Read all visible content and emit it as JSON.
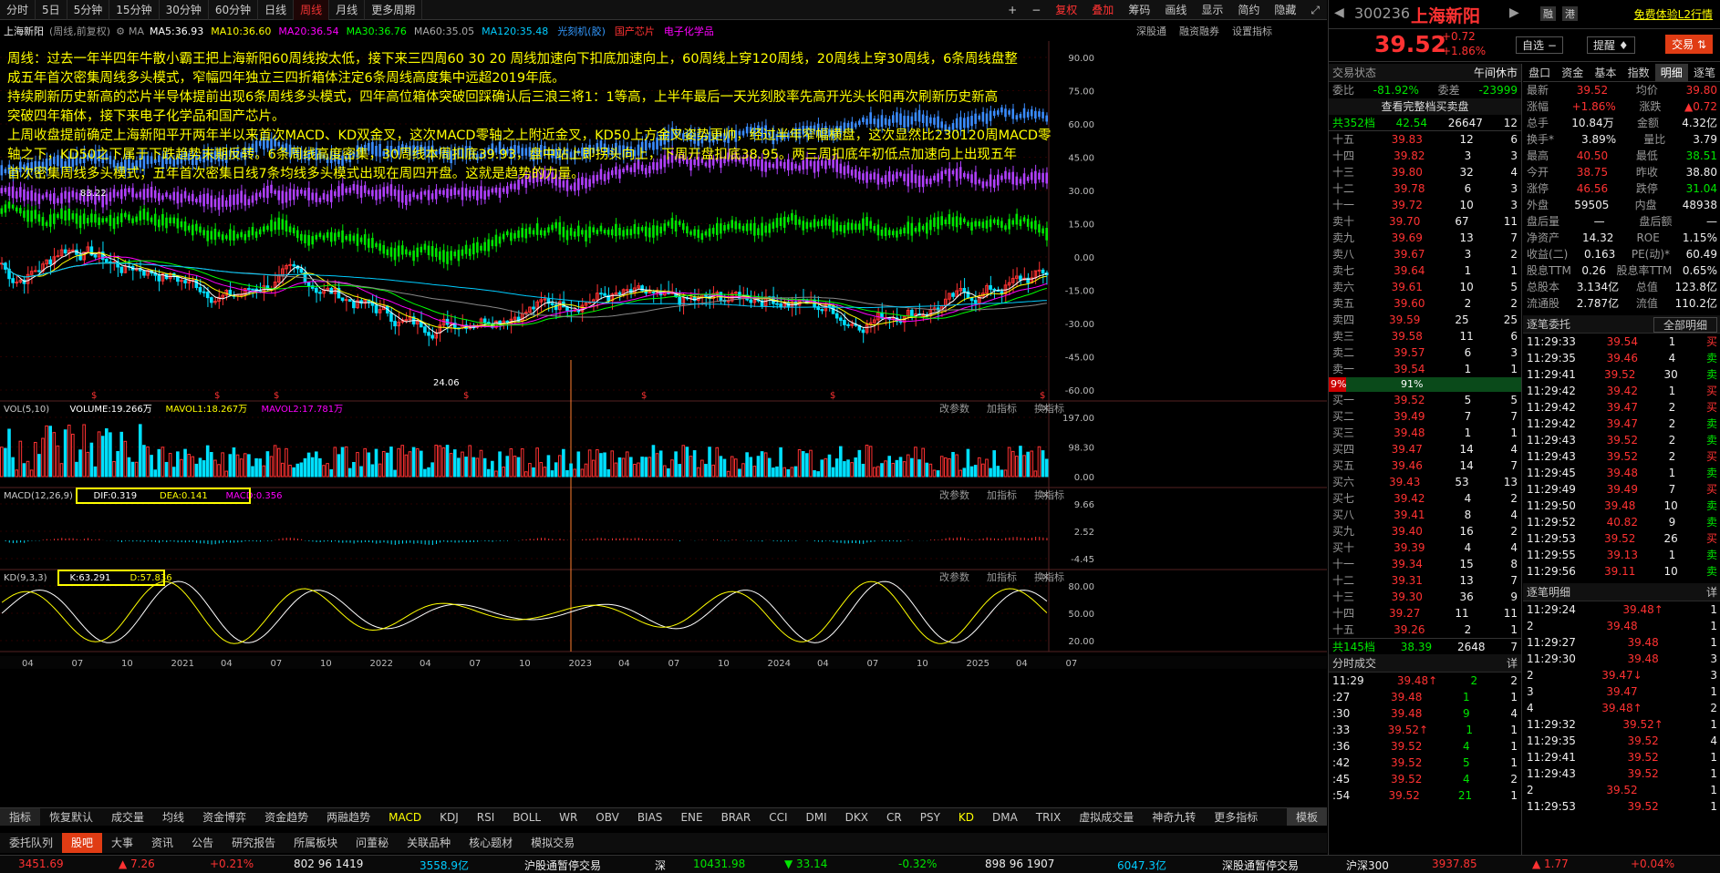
{
  "toolbar": {
    "tabs": [
      "分时",
      "5日",
      "5分钟",
      "15分钟",
      "30分钟",
      "60分钟",
      "日线",
      "周线",
      "月线",
      "更多周期"
    ],
    "active": "周线",
    "right": [
      "+",
      "−",
      "复权",
      "叠加",
      "筹码",
      "画线",
      "显示",
      "简约",
      "隐藏",
      "⤢"
    ]
  },
  "ma_row": {
    "stock": "上海新阳",
    "mode": "(周线,前复权)",
    "ma5": "MA5:36.93",
    "ma10": "MA10:36.60",
    "ma20": "MA20:36.54",
    "ma30": "MA30:36.76",
    "ma60": "MA60:35.05",
    "ma120": "MA120:35.48",
    "tags": [
      "光刻机(胶)",
      "国产芯片",
      "电子化学品"
    ],
    "links": [
      "深股通",
      "融资融券",
      "设置指标"
    ]
  },
  "annotation": [
    "周线：过去一年半四年牛散小霸王把上海新阳60周线按太低，接下来三四周60 30 20 周线加速向下扣底加速向上，60周线上穿120周线，20周线上穿30周线，6条周线盘整",
    "成五年首次密集周线多头模式，窄幅四年独立三四折箱体注定6条周线高度集中远超2019年底。",
    "持续刷新历史新高的芯片半导体提前出现6条周线多头模式，四年高位箱体突破回踩确认后三浪三将1：1等高，上半年最后一天光刻胶率先高开光头长阳再次刷新历史新高",
    "突破四年箱体，接下来电子化学品和国产芯片。",
    "上周收盘提前确定上海新阳平开两年半以来首次MACD、KD双金叉，这次MACD零轴之上附近金叉，KD50上方金叉姿势更帅，经过半年窄幅横盘，这次显然比230120周MACD零",
    "轴之下，KD50之下属于下跌趋势末期反转。6条周线高度密集，30周线本周扣底39.93，盘中站上即拐头向上，下周开盘扣底38.95。两三周扣底年初低点加速向上出现五年",
    "首次密集周线多头模式；五年首次密集日线7条均线多头模式出现在周四开盘。这就是趋势的力量。"
  ],
  "price_axis": [
    "90.00",
    "75.00",
    "60.00",
    "45.00",
    "30.00",
    "15.00",
    "0.00",
    "-15.00",
    "-30.00",
    "-45.00",
    "-60.00"
  ],
  "hi_label": "83.22",
  "lo_label": "24.06",
  "vol": {
    "title": "VOL(5,10)",
    "volume": "VOLUME:19.266万",
    "mavol1": "MAVOL1:18.267万",
    "mavol2": "MAVOL2:17.781万",
    "axis": [
      "197.00",
      "98.30",
      "0.00"
    ]
  },
  "macd": {
    "title": "MACD(12,26,9)",
    "dif": "DIF:0.319",
    "dea": "DEA:0.141",
    "macd": "MACD:0.356",
    "axis": [
      "9.66",
      "2.52",
      "-4.45"
    ]
  },
  "kd": {
    "title": "KD(9,3,3)",
    "k": "K:63.291",
    "d": "D:57.836",
    "axis": [
      "80.00",
      "50.00",
      "20.00"
    ]
  },
  "panel_btns": [
    "改参数",
    "加指标",
    "换指标"
  ],
  "xaxis": [
    "04",
    "07",
    "10",
    "2021",
    "04",
    "07",
    "10",
    "2022",
    "04",
    "07",
    "10",
    "2023",
    "04",
    "07",
    "10",
    "2024",
    "04",
    "07",
    "10",
    "2025",
    "04",
    "07"
  ],
  "ind_tabs": [
    "指标",
    "恢复默认",
    "成交量",
    "均线",
    "资金博弈",
    "资金趋势",
    "两融趋势",
    "MACD",
    "KDJ",
    "RSI",
    "BOLL",
    "WR",
    "OBV",
    "BIAS",
    "ENE",
    "BRAR",
    "CCI",
    "DMI",
    "DKX",
    "CR",
    "PSY",
    "KD",
    "DMA",
    "TRIX",
    "虚拟成交量",
    "神奇九转",
    "更多指标",
    "模板"
  ],
  "bot_tabs": [
    "委托队列",
    "股吧",
    "大事",
    "资讯",
    "公告",
    "研究报告",
    "所属板块",
    "问董秘",
    "关联品种",
    "核心题材",
    "模拟交易"
  ],
  "status": {
    "sh": "3451.69",
    "sh_chg": "▲ 7.26",
    "sh_pct": "+0.21%",
    "sh_cnt": "802 96 1419",
    "sh_amt": "3558.9亿",
    "sh_note": "沪股通暂停交易",
    "sz_lbl": "深",
    "sz": "10431.98",
    "sz_chg": "▼ 33.14",
    "sz_pct": "-0.32%",
    "sz_cnt": "898 96 1907",
    "sz_amt": "6047.3亿",
    "sz_note": "深股通暂停交易",
    "hs_lbl": "沪深300",
    "hs": "3937.85",
    "hs_chg": "▲ 1.77",
    "hs_pct": "+0.04%"
  },
  "rp": {
    "code": "300236",
    "name": "上海新阳",
    "badges": [
      "融",
      "港"
    ],
    "promo": "免费体验L2行情",
    "price": "39.52",
    "chg": "+0.72",
    "pct": "+1.86%",
    "btns": [
      "自选 −",
      "提醒 ♦",
      "交易 ⇅"
    ],
    "state_lbl": "交易状态",
    "state": "午间休市",
    "tabs": [
      "盘口",
      "资金",
      "基本",
      "指数",
      "明细",
      "逐笔"
    ],
    "weibi": [
      "委比",
      "-81.92%",
      "委差",
      "-23999"
    ],
    "full_btn": "查看完整档买卖盘",
    "sell_sum": [
      "共352档",
      "42.54",
      "26647",
      "12"
    ],
    "sells": [
      [
        "十五",
        "39.83",
        "12",
        "6"
      ],
      [
        "十四",
        "39.82",
        "3",
        "3"
      ],
      [
        "十三",
        "39.80",
        "32",
        "4"
      ],
      [
        "十二",
        "39.78",
        "6",
        "3"
      ],
      [
        "十一",
        "39.72",
        "10",
        "3"
      ],
      [
        "卖十",
        "39.70",
        "67",
        "11"
      ],
      [
        "卖九",
        "39.69",
        "13",
        "7"
      ],
      [
        "卖八",
        "39.67",
        "3",
        "2"
      ],
      [
        "卖七",
        "39.64",
        "1",
        "1"
      ],
      [
        "卖六",
        "39.61",
        "10",
        "5"
      ],
      [
        "卖五",
        "39.60",
        "2",
        "2"
      ],
      [
        "卖四",
        "39.59",
        "25",
        "25"
      ],
      [
        "卖三",
        "39.58",
        "11",
        "6"
      ],
      [
        "卖二",
        "39.57",
        "6",
        "3"
      ],
      [
        "卖一",
        "39.54",
        "1",
        "1"
      ]
    ],
    "bar": [
      "9%",
      "91%"
    ],
    "buys": [
      [
        "买一",
        "39.52",
        "5",
        "5"
      ],
      [
        "买二",
        "39.49",
        "7",
        "7"
      ],
      [
        "买三",
        "39.48",
        "1",
        "1"
      ],
      [
        "买四",
        "39.47",
        "14",
        "4"
      ],
      [
        "买五",
        "39.46",
        "14",
        "7"
      ],
      [
        "买六",
        "39.43",
        "53",
        "13"
      ],
      [
        "买七",
        "39.42",
        "4",
        "2"
      ],
      [
        "买八",
        "39.41",
        "8",
        "4"
      ],
      [
        "买九",
        "39.40",
        "16",
        "2"
      ],
      [
        "买十",
        "39.39",
        "4",
        "4"
      ],
      [
        "十一",
        "39.34",
        "15",
        "8"
      ],
      [
        "十二",
        "39.31",
        "13",
        "7"
      ],
      [
        "十三",
        "39.30",
        "36",
        "9"
      ],
      [
        "十四",
        "39.27",
        "11",
        "11"
      ],
      [
        "十五",
        "39.26",
        "2",
        "1"
      ]
    ],
    "buy_sum": [
      "共145档",
      "38.39",
      "2648",
      "7"
    ],
    "fenshi_title": "分时成交",
    "detail_lbl": "详",
    "fenshi": [
      [
        "11:29",
        "39.48↑",
        "2",
        "2"
      ],
      [
        ":27",
        "39.48",
        "1",
        "1"
      ],
      [
        ":30",
        "39.48",
        "9",
        "4"
      ],
      [
        ":33",
        "39.52↑",
        "1",
        "1"
      ],
      [
        ":36",
        "39.52",
        "4",
        "1"
      ],
      [
        ":42",
        "39.52",
        "5",
        "1"
      ],
      [
        ":45",
        "39.52",
        "4",
        "2"
      ],
      [
        ":54",
        "39.52",
        "21",
        "1"
      ]
    ],
    "quote": [
      [
        "最新",
        "39.52",
        "均价",
        "39.80"
      ],
      [
        "涨幅",
        "+1.86%",
        "涨跌",
        "▲0.72"
      ],
      [
        "总手",
        "10.84万",
        "金额",
        "4.32亿"
      ],
      [
        "换手*",
        "3.89%",
        "量比",
        "3.79"
      ],
      [
        "最高",
        "40.50",
        "最低",
        "38.51"
      ],
      [
        "今开",
        "38.75",
        "昨收",
        "38.80"
      ],
      [
        "涨停",
        "46.56",
        "跌停",
        "31.04"
      ],
      [
        "外盘",
        "59505",
        "内盘",
        "48938"
      ],
      [
        "盘后量",
        "—",
        "盘后额",
        "—"
      ],
      [
        "净资产",
        "14.32",
        "ROE",
        "1.15%"
      ],
      [
        "收益(二)",
        "0.163",
        "PE(动)*",
        "60.49"
      ],
      [
        "股息TTM",
        "0.26",
        "股息率TTM",
        "0.65%"
      ],
      [
        "总股本",
        "3.134亿",
        "总值",
        "123.8亿"
      ],
      [
        "流通股",
        "2.787亿",
        "流值",
        "110.2亿"
      ]
    ],
    "zhubi_title": "逐笔委托",
    "zhubi_sel": "全部明细",
    "zhubi": [
      [
        "11:29:33",
        "39.54",
        "1",
        "买"
      ],
      [
        "11:29:35",
        "39.46",
        "4",
        "卖"
      ],
      [
        "11:29:41",
        "39.52",
        "30",
        "卖"
      ],
      [
        "11:29:42",
        "39.42",
        "1",
        "买"
      ],
      [
        "11:29:42",
        "39.47",
        "2",
        "买"
      ],
      [
        "11:29:42",
        "39.47",
        "2",
        "卖"
      ],
      [
        "11:29:43",
        "39.52",
        "2",
        "卖"
      ],
      [
        "11:29:43",
        "39.52",
        "2",
        "买"
      ],
      [
        "11:29:45",
        "39.48",
        "1",
        "卖"
      ],
      [
        "11:29:49",
        "39.49",
        "7",
        "买"
      ],
      [
        "11:29:50",
        "39.48",
        "10",
        "卖"
      ],
      [
        "11:29:52",
        "40.82",
        "9",
        "卖"
      ],
      [
        "11:29:53",
        "39.52",
        "26",
        "买"
      ],
      [
        "11:29:55",
        "39.13",
        "1",
        "卖"
      ],
      [
        "11:29:56",
        "39.11",
        "10",
        "卖"
      ]
    ],
    "mingxi_title": "逐笔明细",
    "mingxi": [
      [
        "11:29:24",
        "39.48↑",
        "1"
      ],
      [
        "2",
        "39.48",
        "1"
      ],
      [
        "11:29:27",
        "39.48",
        "1"
      ],
      [
        "11:29:30",
        "39.48",
        "3"
      ],
      [
        "2",
        "39.47↓",
        "3"
      ],
      [
        "3",
        "39.47",
        "1"
      ],
      [
        "4",
        "39.48↑",
        "2"
      ],
      [
        "11:29:32",
        "39.52↑",
        "1"
      ],
      [
        "11:29:35",
        "39.52",
        "4"
      ],
      [
        "11:29:41",
        "39.52",
        "1"
      ],
      [
        "11:29:43",
        "39.52",
        "1"
      ],
      [
        "2",
        "39.52",
        "1"
      ],
      [
        "11:29:53",
        "39.52",
        "1"
      ]
    ]
  },
  "colors": {
    "up": "#ff3232",
    "down": "#00e600",
    "bg": "#000000",
    "grid": "#3a0000",
    "ma5": "#ffffff",
    "ma10": "#ffff00",
    "ma20": "#ff00ff",
    "ma30": "#00ff00",
    "ma60": "#888888",
    "ma120": "#00ccff"
  }
}
